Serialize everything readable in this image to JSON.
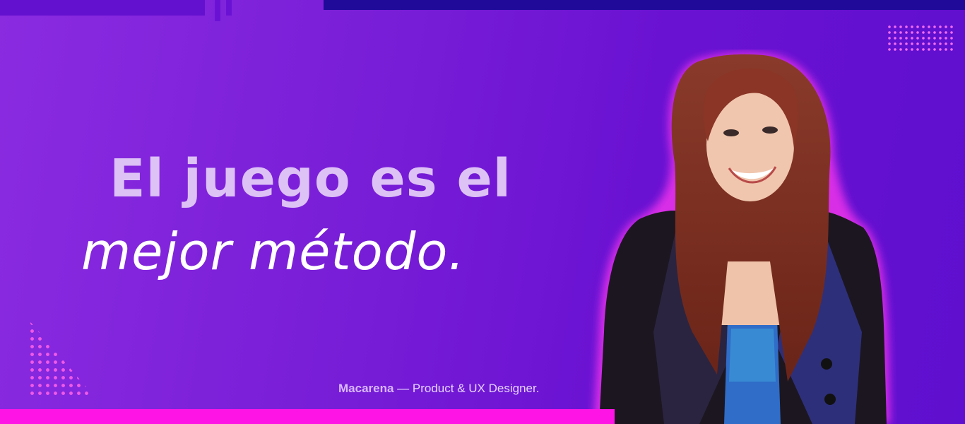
{
  "headline": {
    "line1": "El juego es el",
    "line2": "mejor método."
  },
  "caption": {
    "name": "Macarena",
    "separator": " — ",
    "role": "Product & UX Designer."
  },
  "colors": {
    "background_start": "#8a2be0",
    "background_end": "#5f0fcf",
    "accent_magenta": "#ff14e6",
    "headline_line1": "#ddc2f6",
    "headline_line2": "#ffffff",
    "top_bar": "#1f0a9a"
  }
}
